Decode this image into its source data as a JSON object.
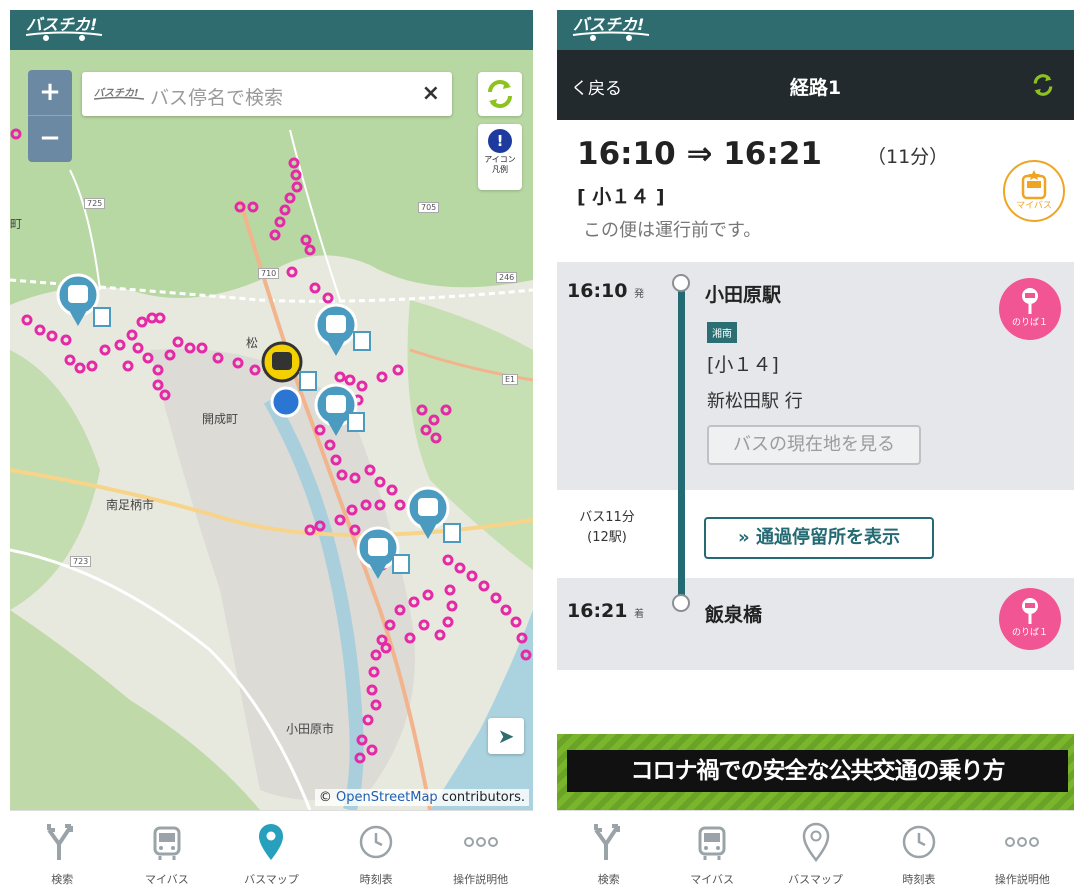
{
  "colors": {
    "topbar": "#2f6c6f",
    "stop_pink": "#e52aa7",
    "accent": "#236a73",
    "mybus": "#f0a424",
    "platform": "#f25593"
  },
  "map_screen": {
    "search_placeholder": "バス停名で検索",
    "clear_label": "×",
    "zoom_in": "+",
    "zoom_out": "−",
    "legend_mark": "!",
    "legend_label_1": "アイコン",
    "legend_label_2": "凡例",
    "attribution_prefix": "© ",
    "attribution_link": "OpenStreetMap",
    "attribution_suffix": " contributors.",
    "place_labels": [
      "開成町",
      "南足柄市",
      "小田原市",
      "町",
      "松"
    ],
    "road_numbers": [
      "725",
      "705",
      "710",
      "246",
      "723",
      "E1"
    ]
  },
  "route_screen": {
    "back_label": "く戻る",
    "title": "経路1",
    "times": "16:10 ⇒ 16:21",
    "duration": "（11分）",
    "route_label": "[ 小１４ ]",
    "status": "この便は運行前です。",
    "mybus_label": "マイバス",
    "departure": {
      "time": "16:10",
      "suffix": "発",
      "stop": "小田原駅",
      "operator_tag": "湘南",
      "route": "[小１４]",
      "destination": "新松田駅 行",
      "now_button": "バスの現在地を見る",
      "platform": "のりば１"
    },
    "ride": {
      "minutes": "バス11分",
      "stops": "(12駅)",
      "via_button": "通過停留所を表示"
    },
    "arrival": {
      "time": "16:21",
      "suffix": "着",
      "stop": "飯泉橋",
      "platform": "のりば１"
    },
    "banner": "コロナ禍での安全な公共交通の乗り方"
  },
  "nav": [
    "検索",
    "マイバス",
    "バスマップ",
    "時刻表",
    "操作説明他"
  ],
  "nav_right": [
    "検索",
    "マイバス",
    "バスマップ",
    "時刻表",
    "操作説明他"
  ]
}
